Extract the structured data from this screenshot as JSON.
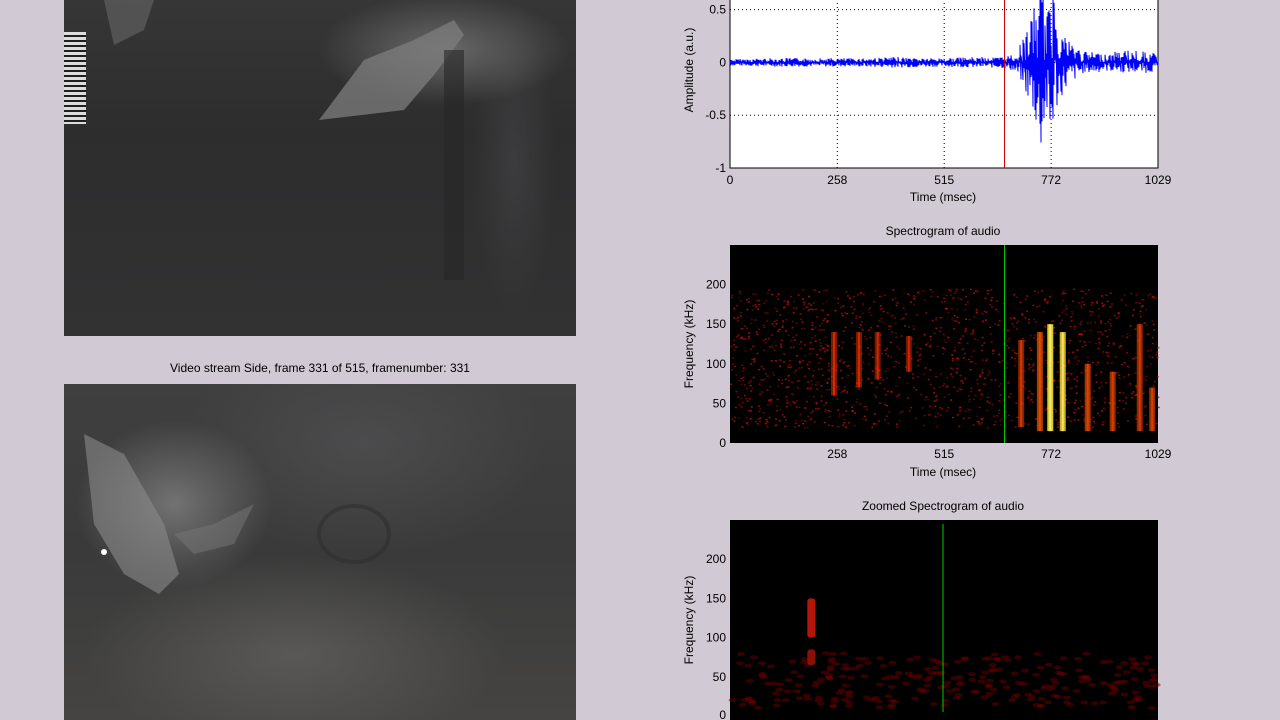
{
  "video_side": {
    "title": "Video stream Side, frame 331 of 515, framenumber: 331"
  },
  "waveform": {
    "ylabel": "Amplitude (a.u.)",
    "xlabel": "Time (msec)",
    "yticks": [
      "0.5",
      "0",
      "-0.5",
      "-1"
    ],
    "xticks": [
      "0",
      "258",
      "515",
      "772",
      "1029"
    ],
    "trace_color": "#0000ff",
    "cursor_color": "#cc0000"
  },
  "spectrogram": {
    "title": "Spectrogram of audio",
    "ylabel": "Frequency (kHz)",
    "xlabel": "Time (msec)",
    "yticks": [
      "200",
      "150",
      "100",
      "50",
      "0"
    ],
    "xticks": [
      "258",
      "515",
      "772",
      "1029"
    ],
    "cursor_color": "#00cc00"
  },
  "zoomed_spectrogram": {
    "title": "Zoomed Spectrogram of audio",
    "ylabel": "Frequency (kHz)",
    "yticks": [
      "200",
      "150",
      "100",
      "50",
      "0"
    ],
    "cursor_color": "#00cc00"
  },
  "chart_data": [
    {
      "type": "line",
      "title": "",
      "xlabel": "Time (msec)",
      "ylabel": "Amplitude (a.u.)",
      "xlim": [
        0,
        1029
      ],
      "ylim": [
        -1,
        0.6
      ],
      "xticks": [
        0,
        258,
        515,
        772,
        1029
      ],
      "yticks": [
        -1,
        -0.5,
        0,
        0.5
      ],
      "grid": true,
      "cursor_x": 660,
      "series": [
        {
          "x": [
            0,
            100,
            200,
            300,
            400,
            500,
            600,
            650,
            680,
            700,
            730,
            750,
            760,
            770,
            780,
            790,
            800,
            820,
            850,
            880,
            900,
            950,
            1000,
            1029
          ],
          "y_max": [
            0.03,
            0.04,
            0.04,
            0.04,
            0.05,
            0.04,
            0.05,
            0.05,
            0.08,
            0.18,
            0.5,
            0.8,
            0.5,
            0.55,
            0.9,
            0.45,
            0.3,
            0.2,
            0.1,
            0.1,
            0.08,
            0.12,
            0.1,
            0.08
          ],
          "y_min": [
            -0.03,
            -0.04,
            -0.04,
            -0.04,
            -0.05,
            -0.04,
            -0.05,
            -0.05,
            -0.08,
            -0.18,
            -0.5,
            -0.9,
            -0.45,
            -0.85,
            -0.55,
            -0.4,
            -0.3,
            -0.2,
            -0.1,
            -0.1,
            -0.08,
            -0.1,
            -0.1,
            -0.08
          ]
        }
      ]
    },
    {
      "type": "heatmap",
      "title": "Spectrogram of audio",
      "xlabel": "Time (msec)",
      "ylabel": "Frequency (kHz)",
      "xlim": [
        0,
        1029
      ],
      "ylim": [
        0,
        250
      ],
      "xticks": [
        258,
        515,
        772,
        1029
      ],
      "yticks": [
        0,
        50,
        100,
        150,
        200
      ],
      "cursor_x": 660,
      "noise_band_khz": [
        20,
        195
      ],
      "bursts": [
        {
          "t": 250,
          "f_low": 60,
          "f_high": 140,
          "intensity": 0.35
        },
        {
          "t": 310,
          "f_low": 70,
          "f_high": 140,
          "intensity": 0.35
        },
        {
          "t": 355,
          "f_low": 80,
          "f_high": 140,
          "intensity": 0.3
        },
        {
          "t": 430,
          "f_low": 90,
          "f_high": 135,
          "intensity": 0.3
        },
        {
          "t": 700,
          "f_low": 20,
          "f_high": 130,
          "intensity": 0.5
        },
        {
          "t": 745,
          "f_low": 15,
          "f_high": 140,
          "intensity": 0.8
        },
        {
          "t": 770,
          "f_low": 15,
          "f_high": 150,
          "intensity": 1.0
        },
        {
          "t": 800,
          "f_low": 15,
          "f_high": 140,
          "intensity": 0.9
        },
        {
          "t": 860,
          "f_low": 15,
          "f_high": 100,
          "intensity": 0.7
        },
        {
          "t": 920,
          "f_low": 15,
          "f_high": 90,
          "intensity": 0.6
        },
        {
          "t": 985,
          "f_low": 15,
          "f_high": 150,
          "intensity": 0.55
        },
        {
          "t": 1015,
          "f_low": 15,
          "f_high": 70,
          "intensity": 0.6
        }
      ]
    },
    {
      "type": "heatmap",
      "title": "Zoomed Spectrogram of audio",
      "ylabel": "Frequency (kHz)",
      "ylim": [
        0,
        250
      ],
      "yticks": [
        0,
        50,
        100,
        150,
        200
      ],
      "cursor_fraction": 0.5,
      "bursts": [
        {
          "fraction": 0.19,
          "f_low": 100,
          "f_high": 150,
          "intensity": 0.8
        },
        {
          "fraction": 0.19,
          "f_low": 65,
          "f_high": 85,
          "intensity": 0.4
        }
      ]
    }
  ]
}
